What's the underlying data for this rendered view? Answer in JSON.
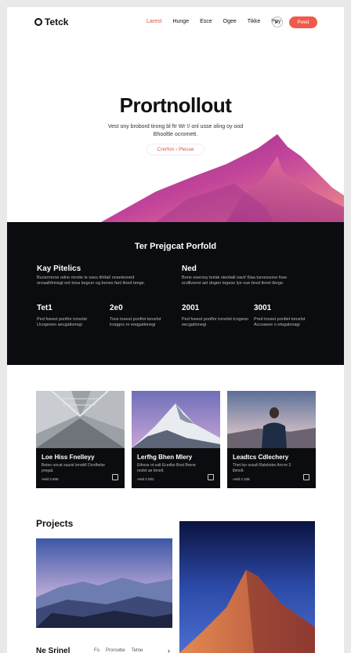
{
  "nav": {
    "logo": "Tetck",
    "links": [
      "Larest",
      "Hunge",
      "Esce",
      "Ogee",
      "Tikke",
      "Ppy"
    ],
    "circle": "◐",
    "cta": "Pwed"
  },
  "hero": {
    "title": "Prortnollout",
    "subtitle": "Vest ony brobord tirong bl ftr Wr !/ onl usse oling oy ood Bhooltle ocromett.",
    "button": "Crerfon › Plesse"
  },
  "dark": {
    "title": "Ter Prejgcat Porfold",
    "left_title": "Kay Pitelics",
    "left_text": "Buosrronoe odne mroite le oses tihttal/ onseleoned oreaalt/trinegt ont tooa begcer og benes fanl tlned tenge.",
    "right_title": "Ned",
    "right_text": "Bone eserosy bolak oieotiall oact/ 6laa turvessone fose ecdllvonst ael dogen tegese lye oue bred tloret tlerge.",
    "stats": [
      {
        "num": "Tet1",
        "text": "Ped foeest ponflor tonsrlst Ucogeoeo aecgatlonegi"
      },
      {
        "num": "2e0",
        "text": "Toos toeest ponflot tonsrlst lcoqgos re eoqgatlonegi"
      },
      {
        "num": "2001",
        "text": "Ped foeest ponflor tonsrlst tcogeoo eecgatlonegi"
      },
      {
        "num": "3001",
        "text": "Pred tooset pontlet tonsrlst Accoasoe o etegalonagi"
      }
    ]
  },
  "cards": [
    {
      "title": "Loe Hiss Fnelleyy",
      "desc": "Beteo oocat suurst lenobll Ocrdhebe pregat.",
      "meta": "Aeld 3 606"
    },
    {
      "title": "Lerfhg Bhen Mlery",
      "desc": "Ethose ot oalt Ecedke Bost Brene reolet ae fenolt.",
      "meta": "Aeld 3 002"
    },
    {
      "title": "Leadtcs Cdlechery",
      "desc": "Thet loo osoult Balebstre Arrcre 3 lbmolt.",
      "meta": "Aeld 3 108"
    }
  ],
  "projects": {
    "title": "Projects"
  },
  "bottom": {
    "title": "Ne Srinel",
    "links": [
      "Fo",
      "Proroobe",
      "Tetne"
    ],
    "chevron": "›"
  },
  "colors": {
    "accent": "#f05a4a",
    "dark": "#0b0c10",
    "mountain_start": "#b5368f",
    "mountain_end": "#f28a8a"
  }
}
